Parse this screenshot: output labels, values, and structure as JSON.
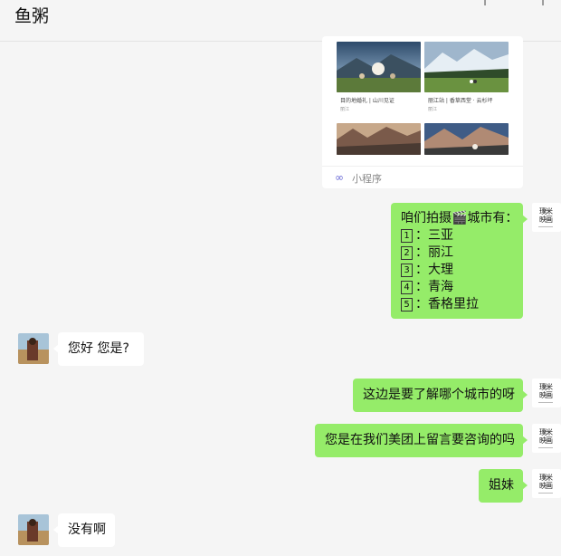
{
  "window": {
    "title": "鱼粥"
  },
  "mini_program": {
    "label": "小程序",
    "captions": [
      {
        "title": "目的地婚礼 | 山川见证",
        "sub": "丽江"
      },
      {
        "title": "丽江站 | 香草西堂 · 云杉坪",
        "sub": "丽江"
      }
    ]
  },
  "messages": [
    {
      "from": "me",
      "lines": [
        "咱们拍摄🎬城市有："
      ],
      "items": [
        {
          "num": "1",
          "text": "三亚"
        },
        {
          "num": "2",
          "text": "丽江"
        },
        {
          "num": "3",
          "text": "大理"
        },
        {
          "num": "4",
          "text": "青海"
        },
        {
          "num": "5",
          "text": "香格里拉"
        }
      ]
    },
    {
      "from": "them",
      "text": "您好 您是?"
    },
    {
      "from": "me",
      "text": "这边是要了解哪个城市的呀"
    },
    {
      "from": "me",
      "text": "您是在我们美团上留言要咨询的吗"
    },
    {
      "from": "me",
      "text": "姐妹"
    },
    {
      "from": "them",
      "text": "没有啊"
    }
  ],
  "my_avatar": {
    "logo": "璞米映画"
  },
  "colors": {
    "my_bubble": "#95ec69",
    "their_bubble": "#ffffff",
    "background": "#f5f5f5"
  }
}
